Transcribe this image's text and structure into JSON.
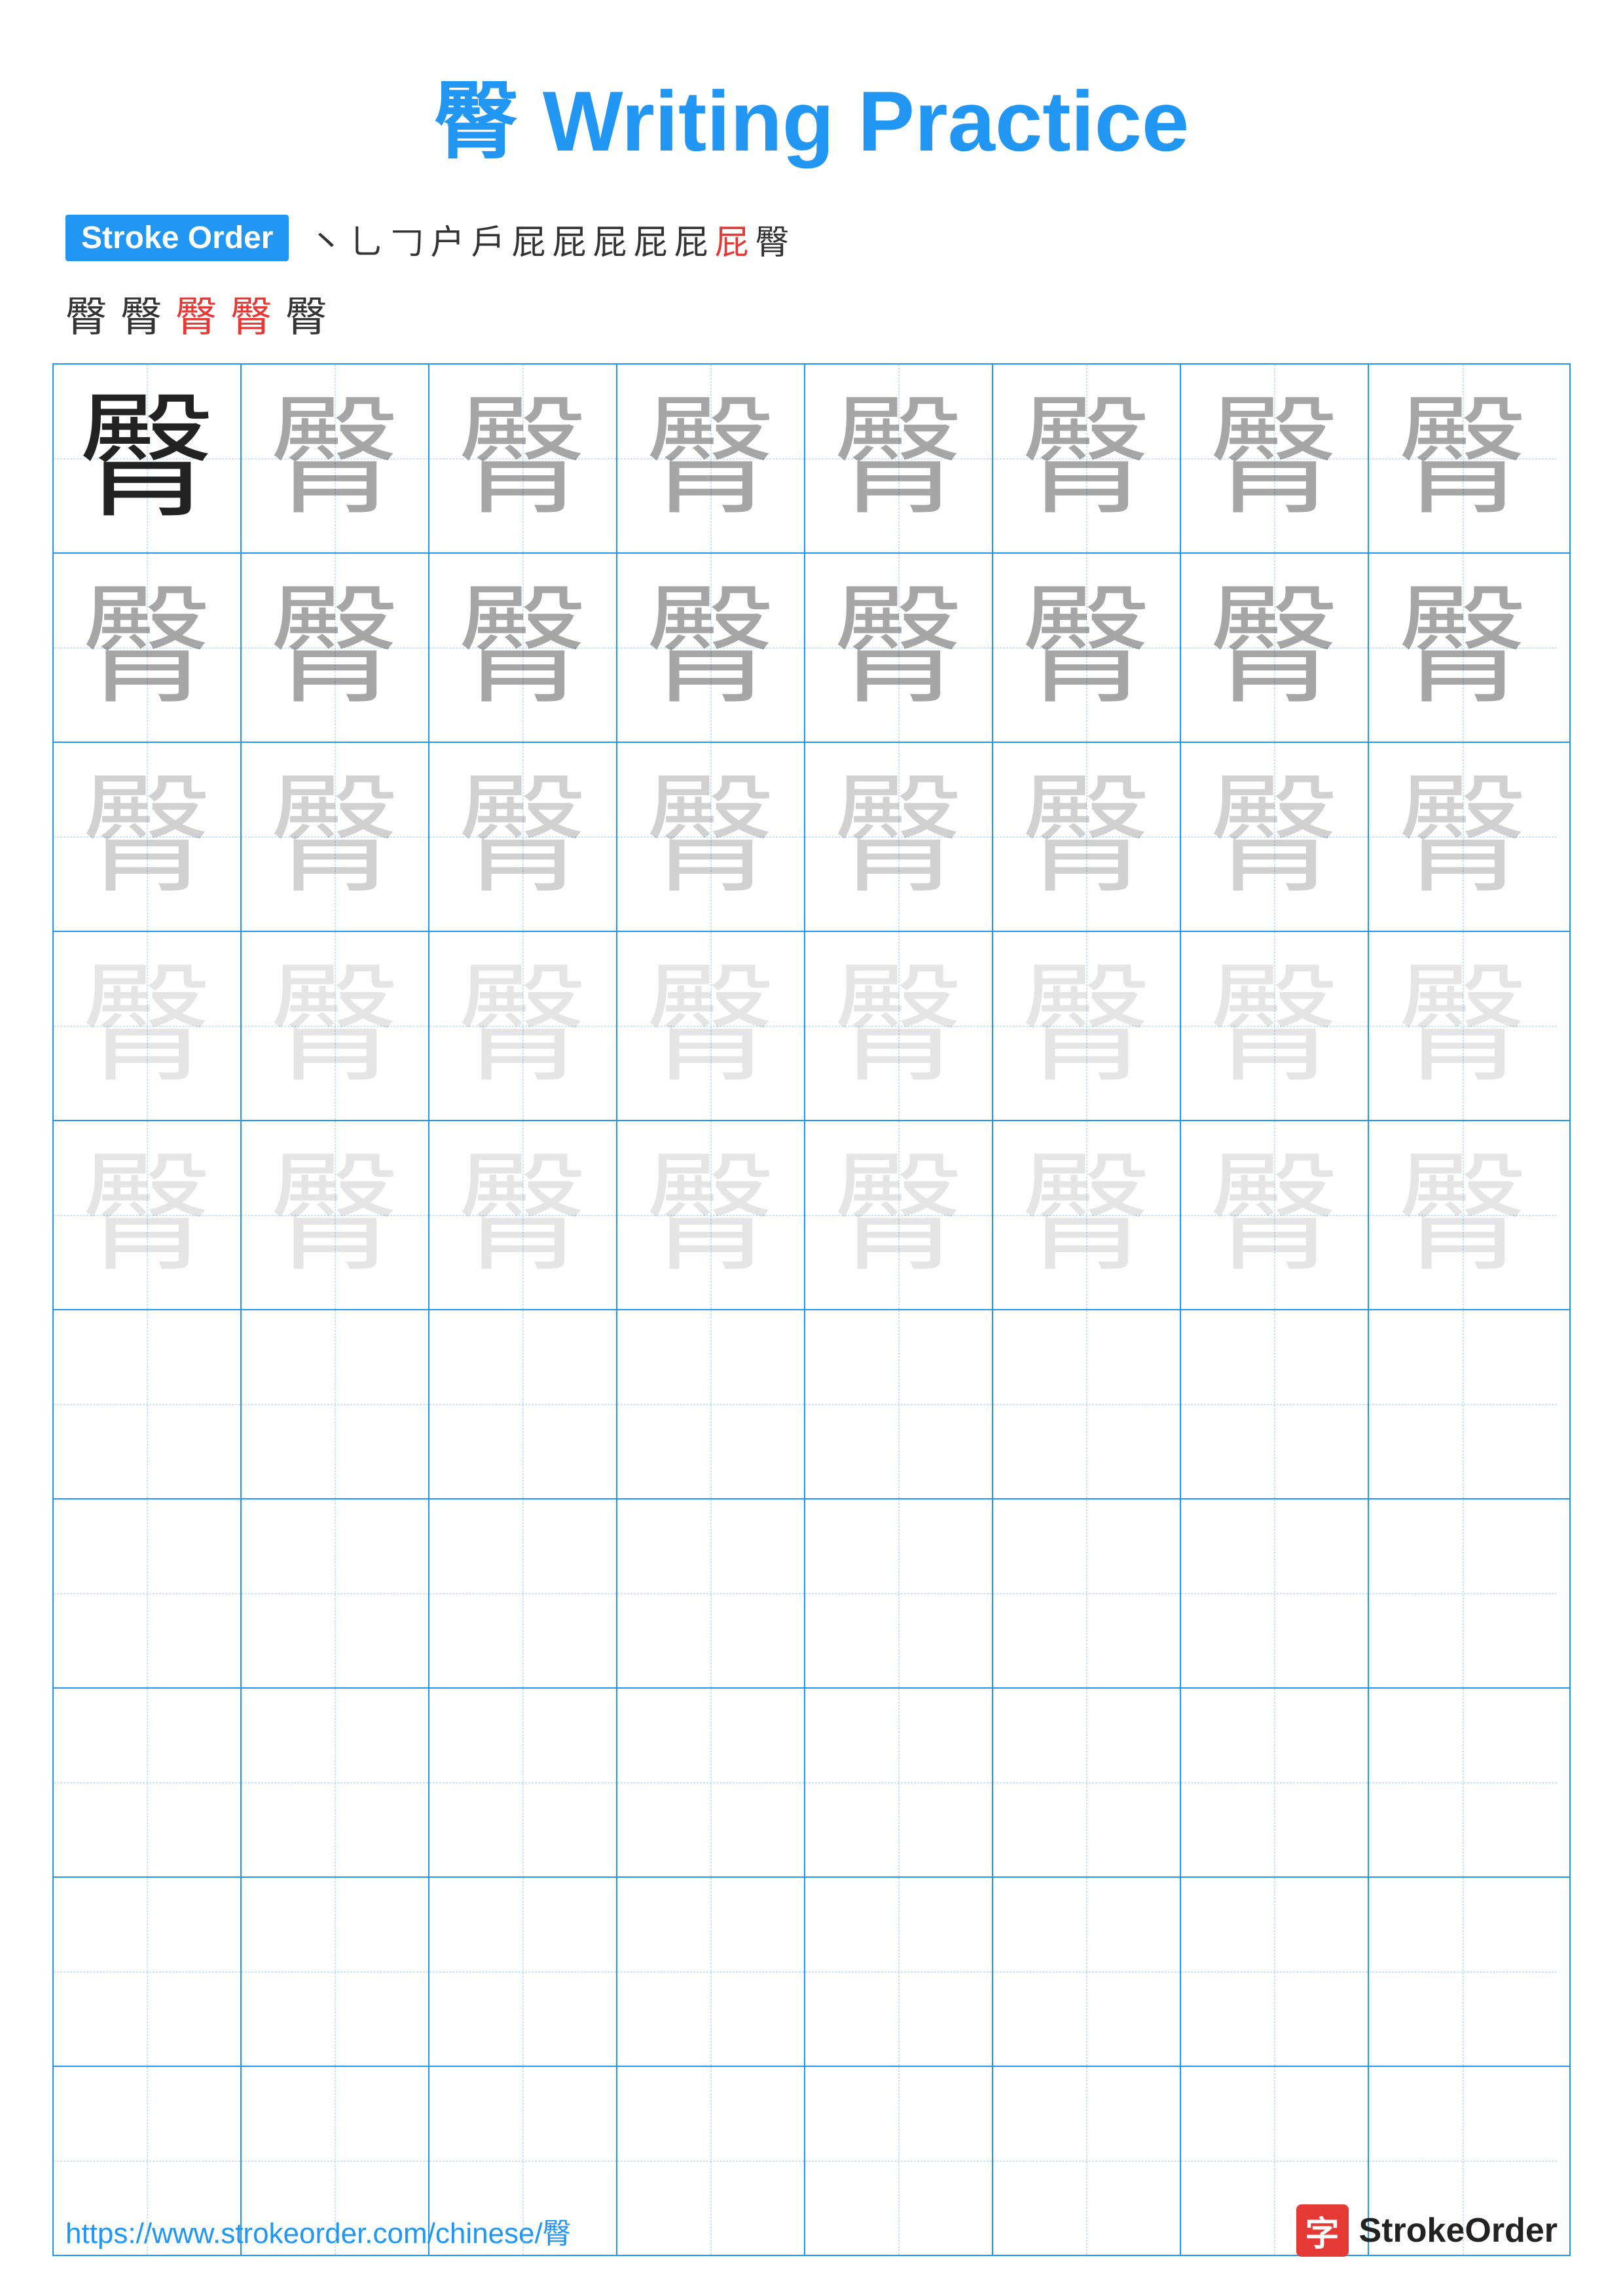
{
  "title": {
    "char": "臀",
    "label": "Writing Practice",
    "full": "臀 Writing Practice"
  },
  "stroke_order": {
    "badge_label": "Stroke Order",
    "strokes": [
      "㇔",
      "⺃",
      "𠃌",
      "户",
      "戶",
      "屁",
      "屁",
      "屁",
      "屁",
      "屁",
      "屁",
      "屁"
    ],
    "line2_strokes": [
      "殿",
      "殿",
      "臀",
      "臀",
      "臀"
    ]
  },
  "grid": {
    "char": "臀",
    "rows": 10,
    "cols": 8
  },
  "footer": {
    "url": "https://www.strokeorder.com/chinese/臀",
    "logo_char": "字",
    "logo_text": "StrokeOrder"
  }
}
